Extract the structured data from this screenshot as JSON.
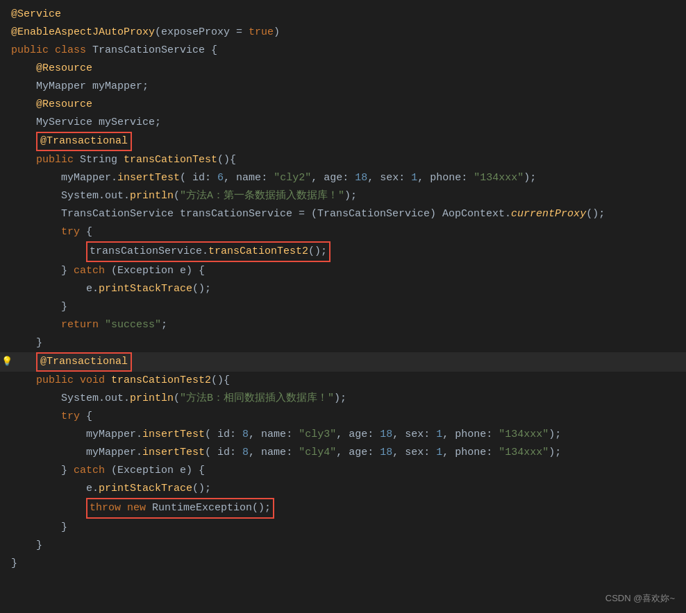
{
  "watermark": "CSDN @喜欢妳~",
  "lines": [
    {
      "id": 1,
      "content": "@Service",
      "type": "annotation-plain"
    },
    {
      "id": 2,
      "content": "@EnableAspectJAutoProxy(exposeProxy = true)",
      "type": "annotation-plain"
    },
    {
      "id": 3,
      "content": "public class TransCationService {",
      "type": "class-decl"
    },
    {
      "id": 4,
      "content": "    @Resource",
      "type": "annotation-plain"
    },
    {
      "id": 5,
      "content": "    MyMapper myMapper;",
      "type": "plain"
    },
    {
      "id": 6,
      "content": "    @Resource",
      "type": "annotation-plain"
    },
    {
      "id": 7,
      "content": "    MyService myService;",
      "type": "plain"
    },
    {
      "id": 8,
      "content": "    @Transactional",
      "type": "annotation-boxed"
    },
    {
      "id": 9,
      "content": "    public String transCationTest(){",
      "type": "method-decl"
    },
    {
      "id": 10,
      "content": "        myMapper.insertTest( id: 6, name: \"cly2\", age: 18, sex: 1, phone: \"134xxx\");",
      "type": "code"
    },
    {
      "id": 11,
      "content": "        System.out.println(\"方法A：第一条数据插入数据库！\");",
      "type": "code"
    },
    {
      "id": 12,
      "content": "        TransCationService transCationService = (TransCationService) AopContext.currentProxy();",
      "type": "code"
    },
    {
      "id": 13,
      "content": "        try {",
      "type": "code"
    },
    {
      "id": 14,
      "content": "            transCationService.transCationTest2();",
      "type": "code-boxed"
    },
    {
      "id": 15,
      "content": "        } catch (Exception e) {",
      "type": "code"
    },
    {
      "id": 16,
      "content": "            e.printStackTrace();",
      "type": "code"
    },
    {
      "id": 17,
      "content": "        }",
      "type": "code"
    },
    {
      "id": 18,
      "content": "        return \"success\";",
      "type": "code"
    },
    {
      "id": 19,
      "content": "    }",
      "type": "code"
    },
    {
      "id": 20,
      "content": "    @Transactional",
      "type": "annotation-boxed-2"
    },
    {
      "id": 21,
      "content": "    public void transCationTest2(){",
      "type": "method-decl"
    },
    {
      "id": 22,
      "content": "        System.out.println(\"方法B：相同数据插入数据库！\");",
      "type": "code"
    },
    {
      "id": 23,
      "content": "        try {",
      "type": "code"
    },
    {
      "id": 24,
      "content": "            myMapper.insertTest( id: 8, name: \"cly3\", age: 18, sex: 1, phone: \"134xxx\");",
      "type": "code"
    },
    {
      "id": 25,
      "content": "            myMapper.insertTest( id: 8, name: \"cly4\", age: 18, sex: 1, phone: \"134xxx\");",
      "type": "code"
    },
    {
      "id": 26,
      "content": "        } catch (Exception e) {",
      "type": "code"
    },
    {
      "id": 27,
      "content": "            e.printStackTrace();",
      "type": "code"
    },
    {
      "id": 28,
      "content": "            throw new RuntimeException();",
      "type": "code-boxed-throw"
    },
    {
      "id": 29,
      "content": "        }",
      "type": "code"
    },
    {
      "id": 30,
      "content": "    }",
      "type": "code"
    },
    {
      "id": 31,
      "content": "}",
      "type": "code"
    }
  ]
}
